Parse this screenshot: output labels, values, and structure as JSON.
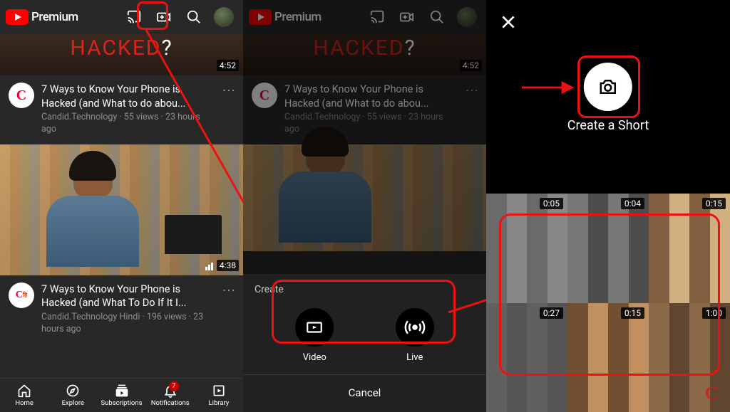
{
  "brand": "Premium",
  "video1": {
    "hacked_text": "HACKED",
    "hacked_q": "?",
    "duration": "4:52",
    "title": "7 Ways to Know Your Phone is Hacked (and What to do abou...",
    "meta": "Candid.Technology · 55 views · 23 hours ago"
  },
  "video2": {
    "duration": "4:38",
    "title": "7 Ways to Know Your Phone is Hacked (and What To Do If It I...",
    "meta": "Candid.Technology Hindi · 196 views · 23 hours ago"
  },
  "bottom_nav": {
    "home": "Home",
    "explore": "Explore",
    "subscriptions": "Subscriptions",
    "notifications": "Notifications",
    "notif_badge": "7",
    "library": "Library"
  },
  "sheet": {
    "title": "Create",
    "video": "Video",
    "live": "Live",
    "cancel": "Cancel"
  },
  "short": {
    "label": "Create a Short"
  },
  "gallery": {
    "durations": [
      "0:05",
      "0:04",
      "0:15",
      "0:27",
      "0:15",
      "1:00"
    ]
  }
}
